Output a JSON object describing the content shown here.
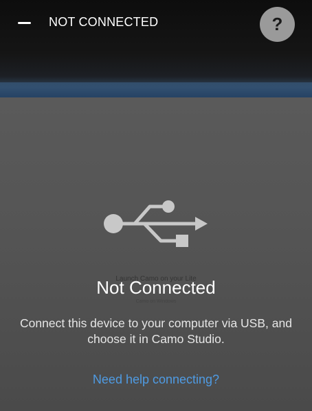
{
  "header": {
    "title": "NOT CONNECTED",
    "menu_icon": "minus-icon",
    "help_label": "?"
  },
  "main": {
    "icon": "usb-icon",
    "background_caption": "Launch Camo on your Lite",
    "background_subcaption": "Camo on Windows",
    "status_title": "Not Connected",
    "instructions": "Connect this device to your computer via USB, and choose it in Camo Studio.",
    "help_link": "Need help connecting?"
  },
  "colors": {
    "background": "#4f4f4f",
    "header": "#0d0d0d",
    "help_button": "#9a9a9a",
    "link": "#4f9be3",
    "icon": "#c8c8c8"
  }
}
